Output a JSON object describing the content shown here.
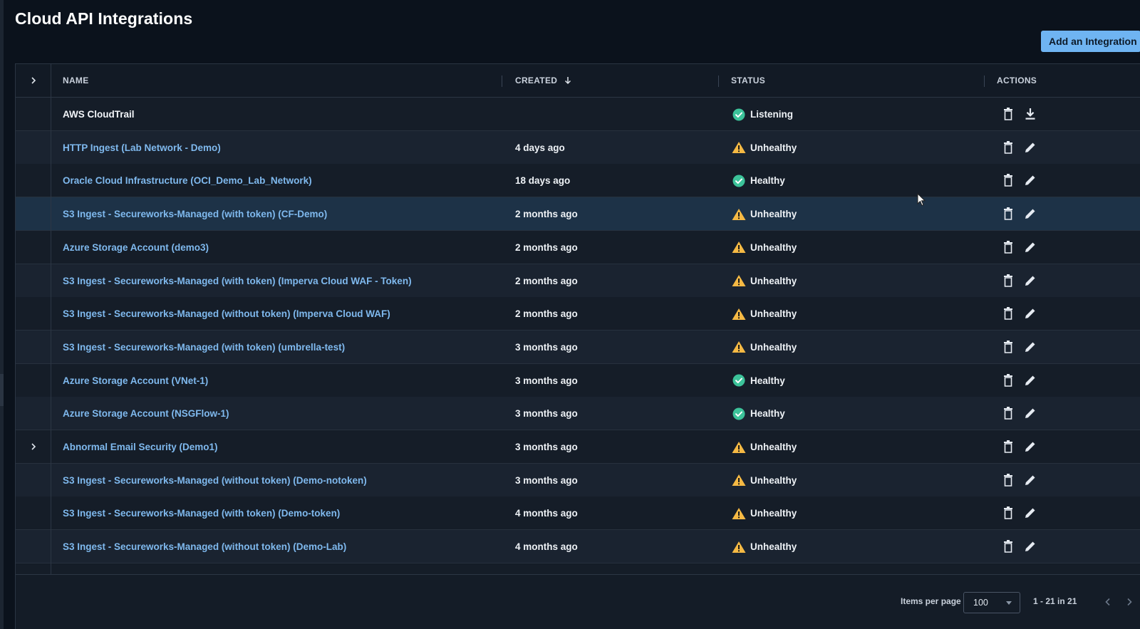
{
  "page": {
    "title": "Cloud API Integrations",
    "add_button": "Add an Integration"
  },
  "table": {
    "columns": {
      "name": "NAME",
      "created": "CREATED",
      "status": "STATUS",
      "actions": "ACTIONS"
    },
    "sort": {
      "column": "created",
      "direction": "descending",
      "icon": "arrow-down-icon"
    },
    "rows": [
      {
        "name": "AWS CloudTrail",
        "created": "",
        "status": "Listening",
        "status_type": "ok",
        "link": false,
        "expandable": false,
        "actions": [
          "delete",
          "download"
        ]
      },
      {
        "name": "HTTP Ingest (Lab Network - Demo)",
        "created": "4 days ago",
        "status": "Unhealthy",
        "status_type": "warn",
        "link": true,
        "expandable": false,
        "actions": [
          "delete",
          "edit"
        ]
      },
      {
        "name": "Oracle Cloud Infrastructure (OCI_Demo_Lab_Network)",
        "created": "18 days ago",
        "status": "Healthy",
        "status_type": "ok",
        "link": true,
        "expandable": false,
        "actions": [
          "delete",
          "edit"
        ]
      },
      {
        "name": "S3 Ingest - Secureworks-Managed (with token) (CF-Demo)",
        "created": "2 months ago",
        "status": "Unhealthy",
        "status_type": "warn",
        "link": true,
        "expandable": false,
        "selected": true,
        "actions": [
          "delete",
          "edit"
        ]
      },
      {
        "name": "Azure Storage Account (demo3)",
        "created": "2 months ago",
        "status": "Unhealthy",
        "status_type": "warn",
        "link": true,
        "expandable": false,
        "actions": [
          "delete",
          "edit"
        ]
      },
      {
        "name": "S3 Ingest - Secureworks-Managed (with token) (Imperva Cloud WAF - Token)",
        "created": "2 months ago",
        "status": "Unhealthy",
        "status_type": "warn",
        "link": true,
        "expandable": false,
        "actions": [
          "delete",
          "edit"
        ]
      },
      {
        "name": "S3 Ingest - Secureworks-Managed (without token) (Imperva Cloud WAF)",
        "created": "2 months ago",
        "status": "Unhealthy",
        "status_type": "warn",
        "link": true,
        "expandable": false,
        "actions": [
          "delete",
          "edit"
        ]
      },
      {
        "name": "S3 Ingest - Secureworks-Managed (with token) (umbrella-test)",
        "created": "3 months ago",
        "status": "Unhealthy",
        "status_type": "warn",
        "link": true,
        "expandable": false,
        "actions": [
          "delete",
          "edit"
        ]
      },
      {
        "name": "Azure Storage Account (VNet-1)",
        "created": "3 months ago",
        "status": "Healthy",
        "status_type": "ok",
        "link": true,
        "expandable": false,
        "actions": [
          "delete",
          "edit"
        ]
      },
      {
        "name": "Azure Storage Account (NSGFlow-1)",
        "created": "3 months ago",
        "status": "Healthy",
        "status_type": "ok",
        "link": true,
        "expandable": false,
        "actions": [
          "delete",
          "edit"
        ]
      },
      {
        "name": "Abnormal Email Security (Demo1)",
        "created": "3 months ago",
        "status": "Unhealthy",
        "status_type": "warn",
        "link": true,
        "expandable": true,
        "actions": [
          "delete",
          "edit"
        ]
      },
      {
        "name": "S3 Ingest - Secureworks-Managed (without token) (Demo-notoken)",
        "created": "3 months ago",
        "status": "Unhealthy",
        "status_type": "warn",
        "link": true,
        "expandable": false,
        "actions": [
          "delete",
          "edit"
        ]
      },
      {
        "name": "S3 Ingest - Secureworks-Managed (with token) (Demo-token)",
        "created": "4 months ago",
        "status": "Unhealthy",
        "status_type": "warn",
        "link": true,
        "expandable": false,
        "actions": [
          "delete",
          "edit"
        ]
      },
      {
        "name": "S3 Ingest - Secureworks-Managed (without token) (Demo-Lab)",
        "created": "4 months ago",
        "status": "Unhealthy",
        "status_type": "warn",
        "link": true,
        "expandable": false,
        "actions": [
          "delete",
          "edit"
        ]
      }
    ]
  },
  "pagination": {
    "items_per_page_label": "Items per page",
    "items_per_page": "100",
    "range": "1 - 21 in 21"
  },
  "colors": {
    "background": "#0b121c",
    "link": "#7fb9ee",
    "accent_button": "#6fb4f2",
    "healthy": "#3cc39a",
    "warning": "#f5b944"
  },
  "icons": {
    "expand": "chevron-right-icon",
    "healthy": "check-circle-icon",
    "unhealthy": "warning-triangle-icon",
    "delete": "trash-icon",
    "edit": "pencil-icon",
    "download": "download-icon",
    "prev": "chevron-left-icon",
    "next": "chevron-right-icon"
  }
}
